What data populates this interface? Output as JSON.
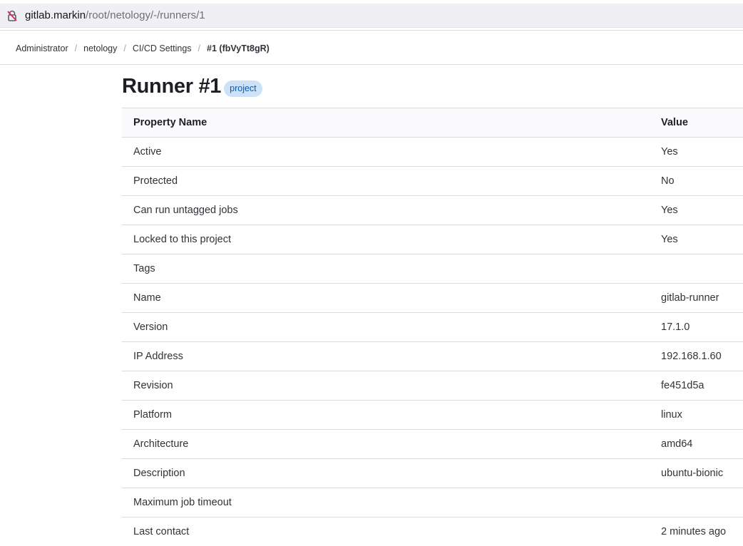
{
  "browser": {
    "url_host": "gitlab.markin",
    "url_path": "/root/netology/-/runners/1",
    "lock_icon": "insecure-lock-icon"
  },
  "breadcrumb": {
    "items": [
      "Administrator",
      "netology",
      "CI/CD Settings"
    ],
    "current": "#1 (fbVyTt8gR)"
  },
  "page": {
    "title": "Runner #1",
    "badge": "project"
  },
  "table": {
    "headers": [
      "Property Name",
      "Value"
    ],
    "rows": [
      {
        "name": "Active",
        "value": "Yes"
      },
      {
        "name": "Protected",
        "value": "No"
      },
      {
        "name": "Can run untagged jobs",
        "value": "Yes"
      },
      {
        "name": "Locked to this project",
        "value": "Yes"
      },
      {
        "name": "Tags",
        "value": ""
      },
      {
        "name": "Name",
        "value": "gitlab-runner"
      },
      {
        "name": "Version",
        "value": "17.1.0"
      },
      {
        "name": "IP Address",
        "value": "192.168.1.60"
      },
      {
        "name": "Revision",
        "value": "fe451d5a"
      },
      {
        "name": "Platform",
        "value": "linux"
      },
      {
        "name": "Architecture",
        "value": "amd64"
      },
      {
        "name": "Description",
        "value": "ubuntu-bionic"
      },
      {
        "name": "Maximum job timeout",
        "value": ""
      },
      {
        "name": "Last contact",
        "value": "2 minutes ago"
      }
    ]
  },
  "colors": {
    "badge_bg": "#cbe2f9",
    "badge_text": "#0b5cad",
    "lock_icon": "#e0245e"
  }
}
